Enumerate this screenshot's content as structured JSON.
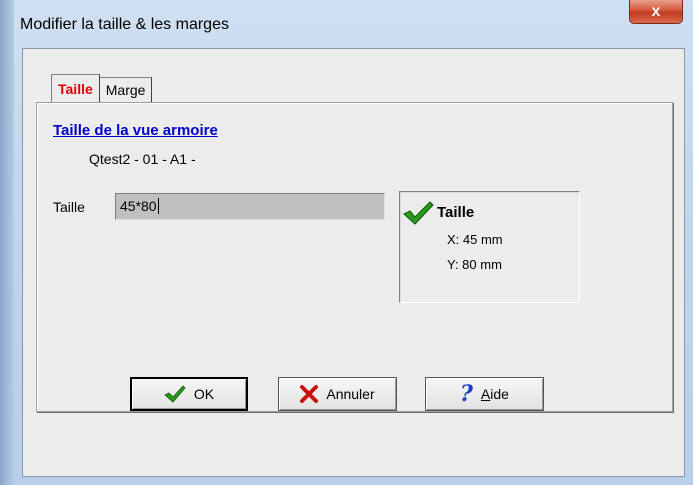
{
  "window": {
    "title": "Modifier la taille & les marges",
    "close_label": "x"
  },
  "tabs": [
    {
      "label": "Taille",
      "active": true
    },
    {
      "label": "Marge",
      "active": false
    }
  ],
  "section": {
    "title": "Taille de la vue armoire",
    "view_name": "Qtest2 - 01 - A1 -"
  },
  "size_field": {
    "label": "Taille",
    "value": "45*80"
  },
  "info": {
    "title": "Taille",
    "x_text": "X: 45 mm",
    "y_text": "Y: 80 mm",
    "icon": "green-check-icon"
  },
  "buttons": {
    "ok": {
      "label": "OK",
      "icon": "green-check-icon"
    },
    "cancel": {
      "label": "Annuler",
      "icon": "red-x-icon"
    },
    "help": {
      "label_first": "A",
      "label_rest": "ide",
      "icon": "question-mark-icon"
    }
  },
  "colors": {
    "active_tab": "#e00000",
    "section_title": "#0000cc",
    "check_green": "#2a9a1a",
    "cancel_red": "#cc1010",
    "help_blue": "#1a3cc8"
  }
}
